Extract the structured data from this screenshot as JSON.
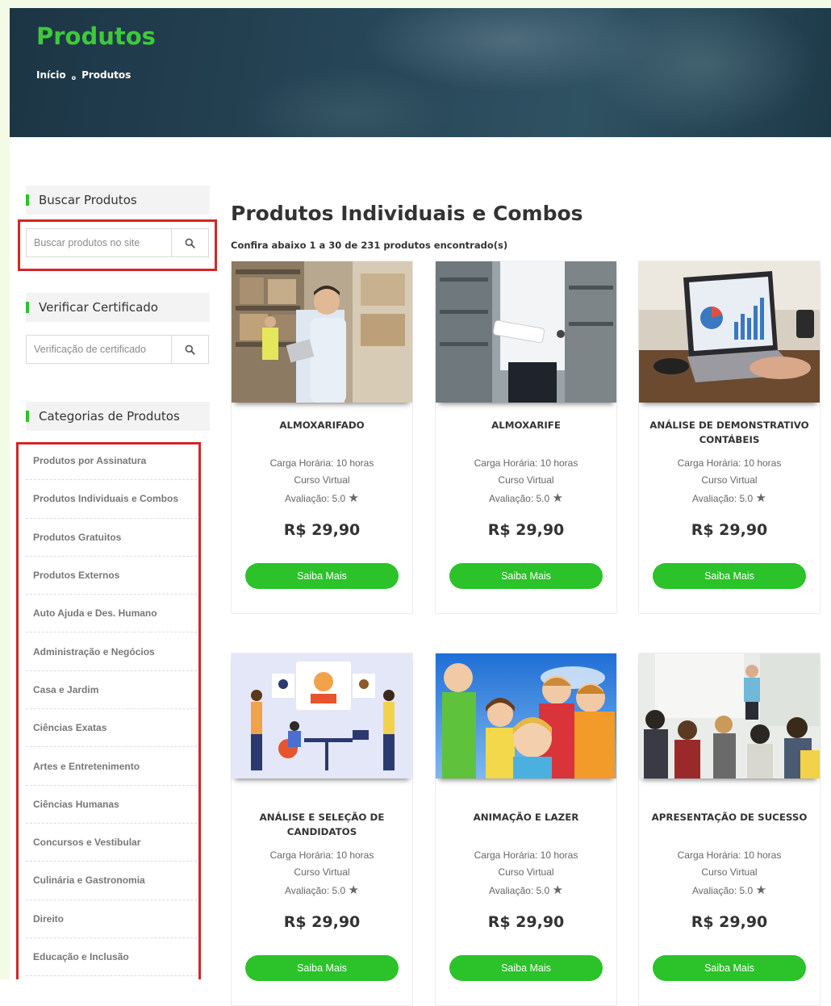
{
  "hero": {
    "title": "Produtos",
    "breadcrumb": {
      "home": "Início",
      "separator": "o",
      "current": "Produtos"
    }
  },
  "sidebar": {
    "search": {
      "title": "Buscar Produtos",
      "placeholder": "Buscar produtos no site"
    },
    "certificate": {
      "title": "Verificar Certificado",
      "placeholder": "Verificação de certificado"
    },
    "categories": {
      "title": "Categorias de Produtos",
      "items": [
        "Produtos por Assinatura",
        "Produtos Individuais e Combos",
        "Produtos Gratuitos",
        "Produtos Externos",
        "Auto Ajuda e Des. Humano",
        "Administração e Negócios",
        "Casa e Jardim",
        "Ciências Exatas",
        "Artes e Entretenimento",
        "Ciências Humanas",
        "Concursos e Vestibular",
        "Culinária e Gastronomia",
        "Direito",
        "Educação e Inclusão"
      ]
    }
  },
  "main": {
    "title": "Produtos Individuais e Combos",
    "result_text": "Confira abaixo 1 a 30 de 231 produtos encontrado(s)",
    "products": [
      {
        "name": "ALMOXARIFADO",
        "hours": "Carga Horária: 10 horas",
        "type": "Curso Virtual",
        "rating": "Avaliação: 5.0",
        "price": "R$ 29,90",
        "cta": "Saiba Mais",
        "image": "warehouse-worker-tablet"
      },
      {
        "name": "ALMOXARIFE",
        "hours": "Carga Horária: 10 horas",
        "type": "Curso Virtual",
        "rating": "Avaliação: 5.0",
        "price": "R$ 29,90",
        "cta": "Saiba Mais",
        "image": "warehouse-clipboard"
      },
      {
        "name": "ANÁLISE DE DEMONSTRATIVO CONTÁBEIS",
        "hours": "Carga Horária: 10 horas",
        "type": "Curso Virtual",
        "rating": "Avaliação: 5.0",
        "price": "R$ 29,90",
        "cta": "Saiba Mais",
        "image": "laptop-charts"
      },
      {
        "name": "ANÁLISE E SELEÇÃO DE CANDIDATOS",
        "hours": "Carga Horária: 10 horas",
        "type": "Curso Virtual",
        "rating": "Avaliação: 5.0",
        "price": "R$ 29,90",
        "cta": "Saiba Mais",
        "image": "recruitment-illustration"
      },
      {
        "name": "ANIMAÇÃO E LAZER",
        "hours": "Carga Horária: 10 horas",
        "type": "Curso Virtual",
        "rating": "Avaliação: 5.0",
        "price": "R$ 29,90",
        "cta": "Saiba Mais",
        "image": "kids-sky"
      },
      {
        "name": "APRESENTAÇÃO DE SUCESSO",
        "hours": "Carga Horária: 10 horas",
        "type": "Curso Virtual",
        "rating": "Avaliação: 5.0",
        "price": "R$ 29,90",
        "cta": "Saiba Mais",
        "image": "presentation-audience"
      }
    ]
  },
  "colors": {
    "accent": "#2bc22a",
    "title_green": "#3fc93a",
    "highlight_red": "#d42626"
  }
}
